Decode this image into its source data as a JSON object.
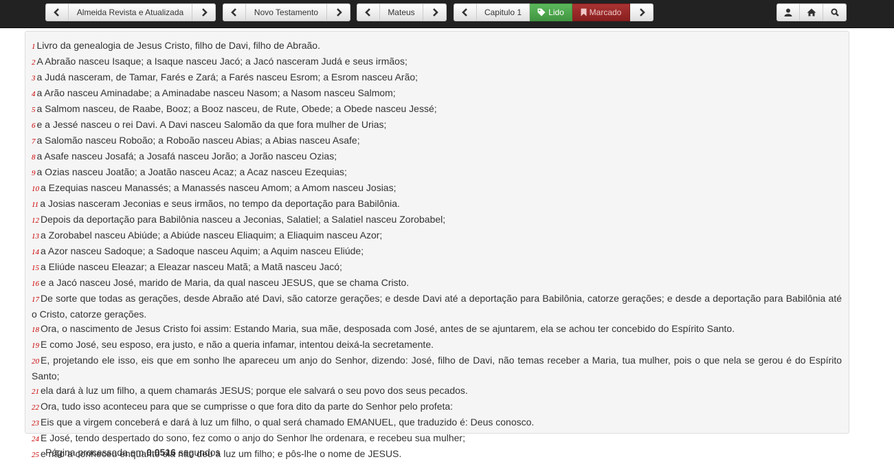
{
  "nav": {
    "version": "Almeida Revista e Atualizada",
    "testament": "Novo Testamento",
    "book": "Mateus",
    "chapter": "Capitulo 1",
    "read_label": "Lido",
    "marked_label": "Marcado"
  },
  "icons": {
    "prev": "chevron-left-icon",
    "next": "chevron-right-icon",
    "read": "tag-icon",
    "marked": "bookmark-icon",
    "user": "user-icon",
    "home": "home-icon",
    "search": "search-icon"
  },
  "colors": {
    "navbar": "#222222",
    "success": "#5cb85c",
    "danger": "#8b2323",
    "verse_number": "#cc0000"
  },
  "verses": [
    {
      "n": "1",
      "text": "Livro da genealogia de Jesus Cristo, filho de Davi, filho de Abraão."
    },
    {
      "n": "2",
      "text": "A Abraão nasceu Isaque; a Isaque nasceu Jacó; a Jacó nasceram Judá e seus irmãos;"
    },
    {
      "n": "3",
      "text": "a Judá nasceram, de Tamar, Farés e Zará; a Farés nasceu Esrom; a Esrom nasceu Arão;"
    },
    {
      "n": "4",
      "text": "a Arão nasceu Aminadabe; a Aminadabe nasceu Nasom; a Nasom nasceu Salmom;"
    },
    {
      "n": "5",
      "text": "a Salmom nasceu, de Raabe, Booz; a Booz nasceu, de Rute, Obede; a Obede nasceu Jessé;"
    },
    {
      "n": "6",
      "text": "e a Jessé nasceu o rei Davi. A Davi nasceu Salomão da que fora mulher de Urias;"
    },
    {
      "n": "7",
      "text": "a Salomão nasceu Roboão; a Roboão nasceu Abias; a Abias nasceu Asafe;"
    },
    {
      "n": "8",
      "text": "a Asafe nasceu Josafá; a Josafá nasceu Jorão; a Jorão nasceu Ozias;"
    },
    {
      "n": "9",
      "text": "a Ozias nasceu Joatão; a Joatão nasceu Acaz; a Acaz nasceu Ezequias;"
    },
    {
      "n": "10",
      "text": "a Ezequias nasceu Manassés; a Manassés nasceu Amom; a Amom nasceu Josias;"
    },
    {
      "n": "11",
      "text": "a Josias nasceram Jeconias e seus irmãos, no tempo da deportação para Babilônia."
    },
    {
      "n": "12",
      "text": "Depois da deportação para Babilônia nasceu a Jeconias, Salatiel; a Salatiel nasceu Zorobabel;"
    },
    {
      "n": "13",
      "text": "a Zorobabel nasceu Abiúde; a Abiúde nasceu Eliaquim; a Eliaquim nasceu Azor;"
    },
    {
      "n": "14",
      "text": "a Azor nasceu Sadoque; a Sadoque nasceu Aquim; a Aquim nasceu Eliúde;"
    },
    {
      "n": "15",
      "text": "a Eliúde nasceu Eleazar; a Eleazar nasceu Matã; a Matã nasceu Jacó;"
    },
    {
      "n": "16",
      "text": "e a Jacó nasceu José, marido de Maria, da qual nasceu JESUS, que se chama Cristo."
    },
    {
      "n": "17",
      "text": "De sorte que todas as gerações, desde Abraão até Davi, são catorze gerações; e desde Davi até a deportação para Babilônia, catorze gerações; e desde a deportação para Babilônia até o Cristo, catorze gerações."
    },
    {
      "n": "18",
      "text": "Ora, o nascimento de Jesus Cristo foi assim: Estando Maria, sua mãe, desposada com José, antes de se ajuntarem, ela se achou ter concebido do Espírito Santo."
    },
    {
      "n": "19",
      "text": "E como José, seu esposo, era justo, e não a queria infamar, intentou deixá-la secretamente."
    },
    {
      "n": "20",
      "text": "E, projetando ele isso, eis que em sonho lhe apareceu um anjo do Senhor, dizendo: José, filho de Davi, não temas receber a Maria, tua mulher, pois o que nela se gerou é do Espírito Santo;"
    },
    {
      "n": "21",
      "text": "ela dará à luz um filho, a quem chamarás JESUS; porque ele salvará o seu povo dos seus pecados."
    },
    {
      "n": "22",
      "text": "Ora, tudo isso aconteceu para que se cumprisse o que fora dito da parte do Senhor pelo profeta:"
    },
    {
      "n": "23",
      "text": "Eis que a virgem conceberá e dará à luz um filho, o qual será chamado EMANUEL, que traduzido é: Deus conosco."
    },
    {
      "n": "24",
      "text": "E José, tendo despertado do sono, fez como o anjo do Senhor lhe ordenara, e recebeu sua mulher;"
    },
    {
      "n": "25",
      "text": "e não a conheceu enquanto ela não deu à luz um filho; e pôs-lhe o nome de JESUS."
    }
  ],
  "footer": {
    "prefix": "Página processada em",
    "time": "0.0516",
    "suffix": "segundos"
  }
}
